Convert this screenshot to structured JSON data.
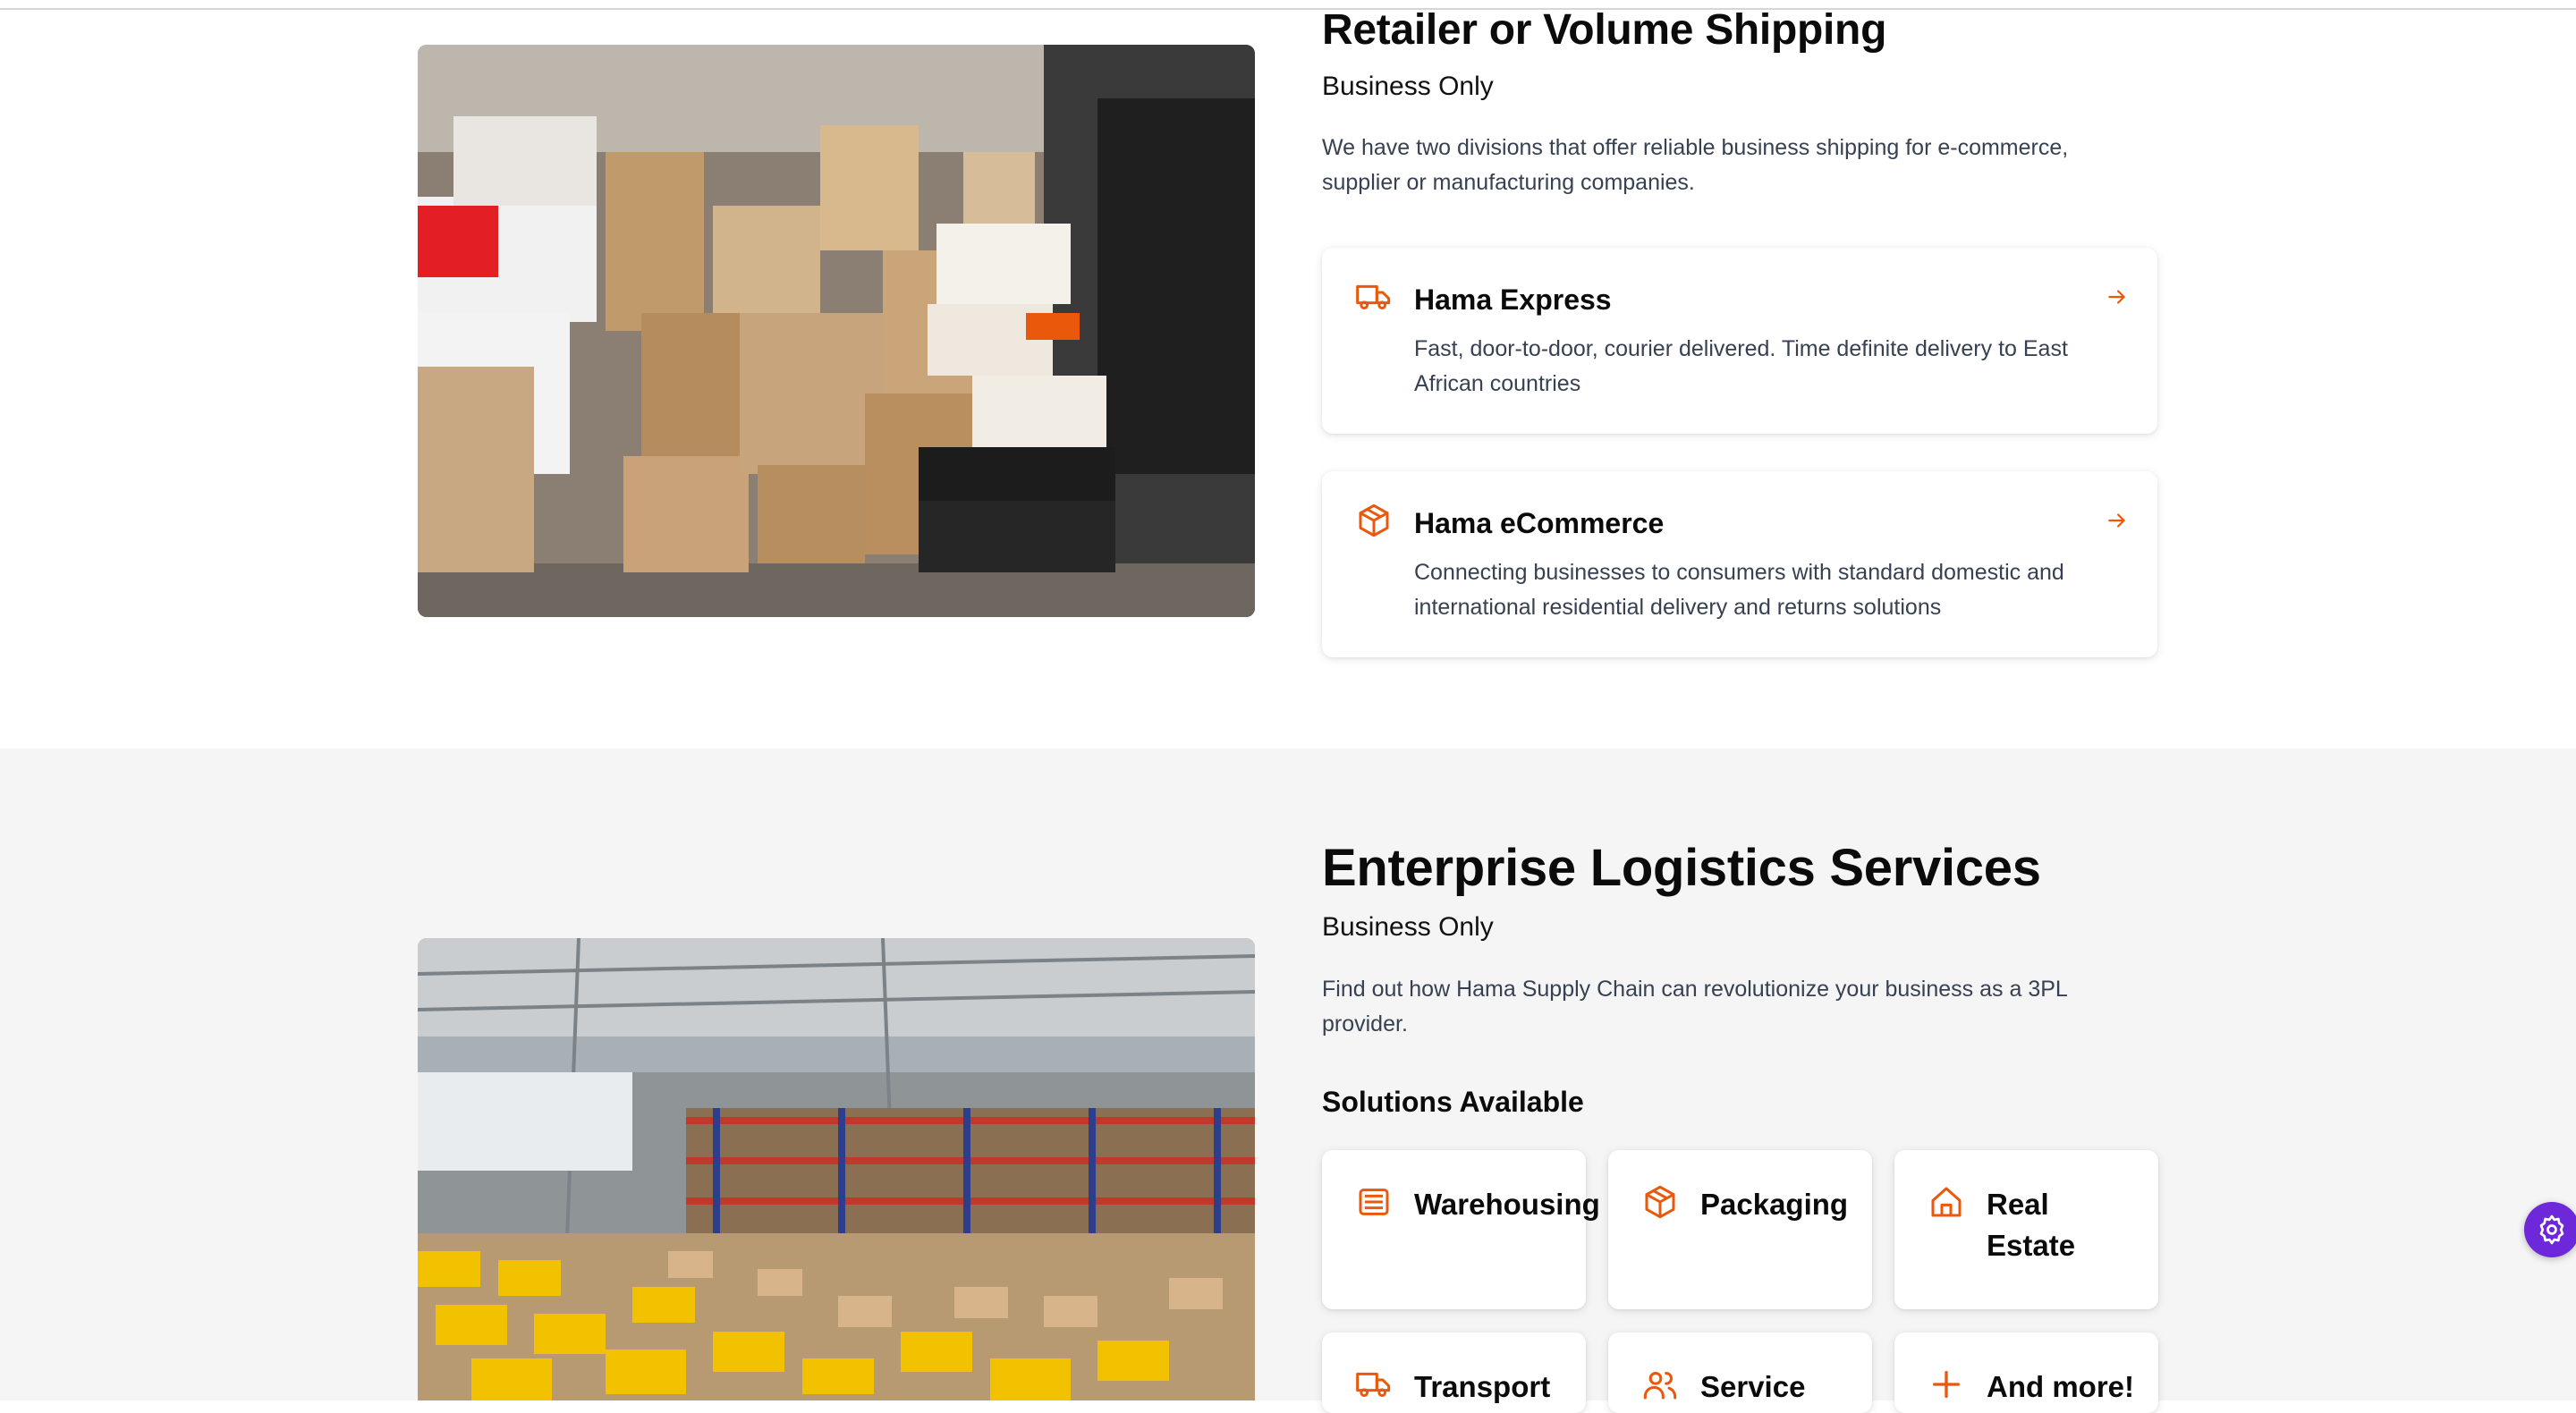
{
  "retail": {
    "title": "Retailer or Volume Shipping",
    "subtitle": "Business Only",
    "description": "We have two divisions that offer reliable business shipping for e-commerce, supplier or manufacturing companies.",
    "cards": [
      {
        "title": "Hama Express",
        "description": "Fast, door-to-door, courier delivered. Time definite delivery to East African countries",
        "icon": "truck-icon"
      },
      {
        "title": "Hama eCommerce",
        "description": "Connecting businesses to consumers with standard domestic and international residential delivery and returns solutions",
        "icon": "package-icon"
      }
    ]
  },
  "enterprise": {
    "title": "Enterprise Logistics Services",
    "subtitle": "Business Only",
    "description": "Find out how Hama Supply Chain can revolutionize your business as a 3PL provider.",
    "solutions_heading": "Solutions Available",
    "solutions": [
      {
        "label": "Warehousing",
        "icon": "warehouse-icon"
      },
      {
        "label": "Packaging",
        "icon": "package-icon"
      },
      {
        "label": "Real Estate",
        "icon": "home-icon"
      },
      {
        "label": "Transport",
        "icon": "truck-icon"
      },
      {
        "label": "Service",
        "icon": "users-icon"
      },
      {
        "label": "And more!",
        "icon": "plus-icon"
      }
    ]
  },
  "colors": {
    "accent": "#ea580c",
    "section_alt_bg": "#f5f5f5",
    "fab": "#6d28d9"
  }
}
